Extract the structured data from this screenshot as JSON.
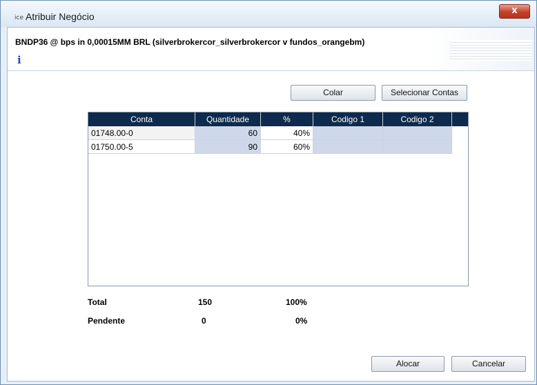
{
  "window": {
    "title": "Atribuir Negócio",
    "app_icon_text": "ice",
    "close_symbol": "x"
  },
  "header": {
    "trade_description": "BNDP36 @  bps in 0,00015MM BRL (silverbrokercor_silverbrokercor v fundos_orangebm)",
    "info_symbol": "i"
  },
  "toolbar": {
    "paste_label": "Colar",
    "select_accounts_label": "Selecionar Contas"
  },
  "table": {
    "columns": [
      "Conta",
      "Quantidade",
      "%",
      "Codigo 1",
      "Codigo 2"
    ],
    "rows": [
      {
        "conta": "01748.00-0",
        "quantidade": "60",
        "pct": "40%",
        "codigo1": "",
        "codigo2": ""
      },
      {
        "conta": "01750.00-5",
        "quantidade": "90",
        "pct": "60%",
        "codigo1": "",
        "codigo2": ""
      }
    ]
  },
  "summary": {
    "total": {
      "label": "Total",
      "quantity": "150",
      "pct": "100%"
    },
    "pending": {
      "label": "Pendente",
      "quantity": "0",
      "pct": "0%"
    }
  },
  "footer": {
    "allocate_label": "Alocar",
    "cancel_label": "Cancelar"
  },
  "colors": {
    "header_bg": "#0e2a4c",
    "editable_cell": "#cfd8ea",
    "close_button": "#c4402b"
  }
}
